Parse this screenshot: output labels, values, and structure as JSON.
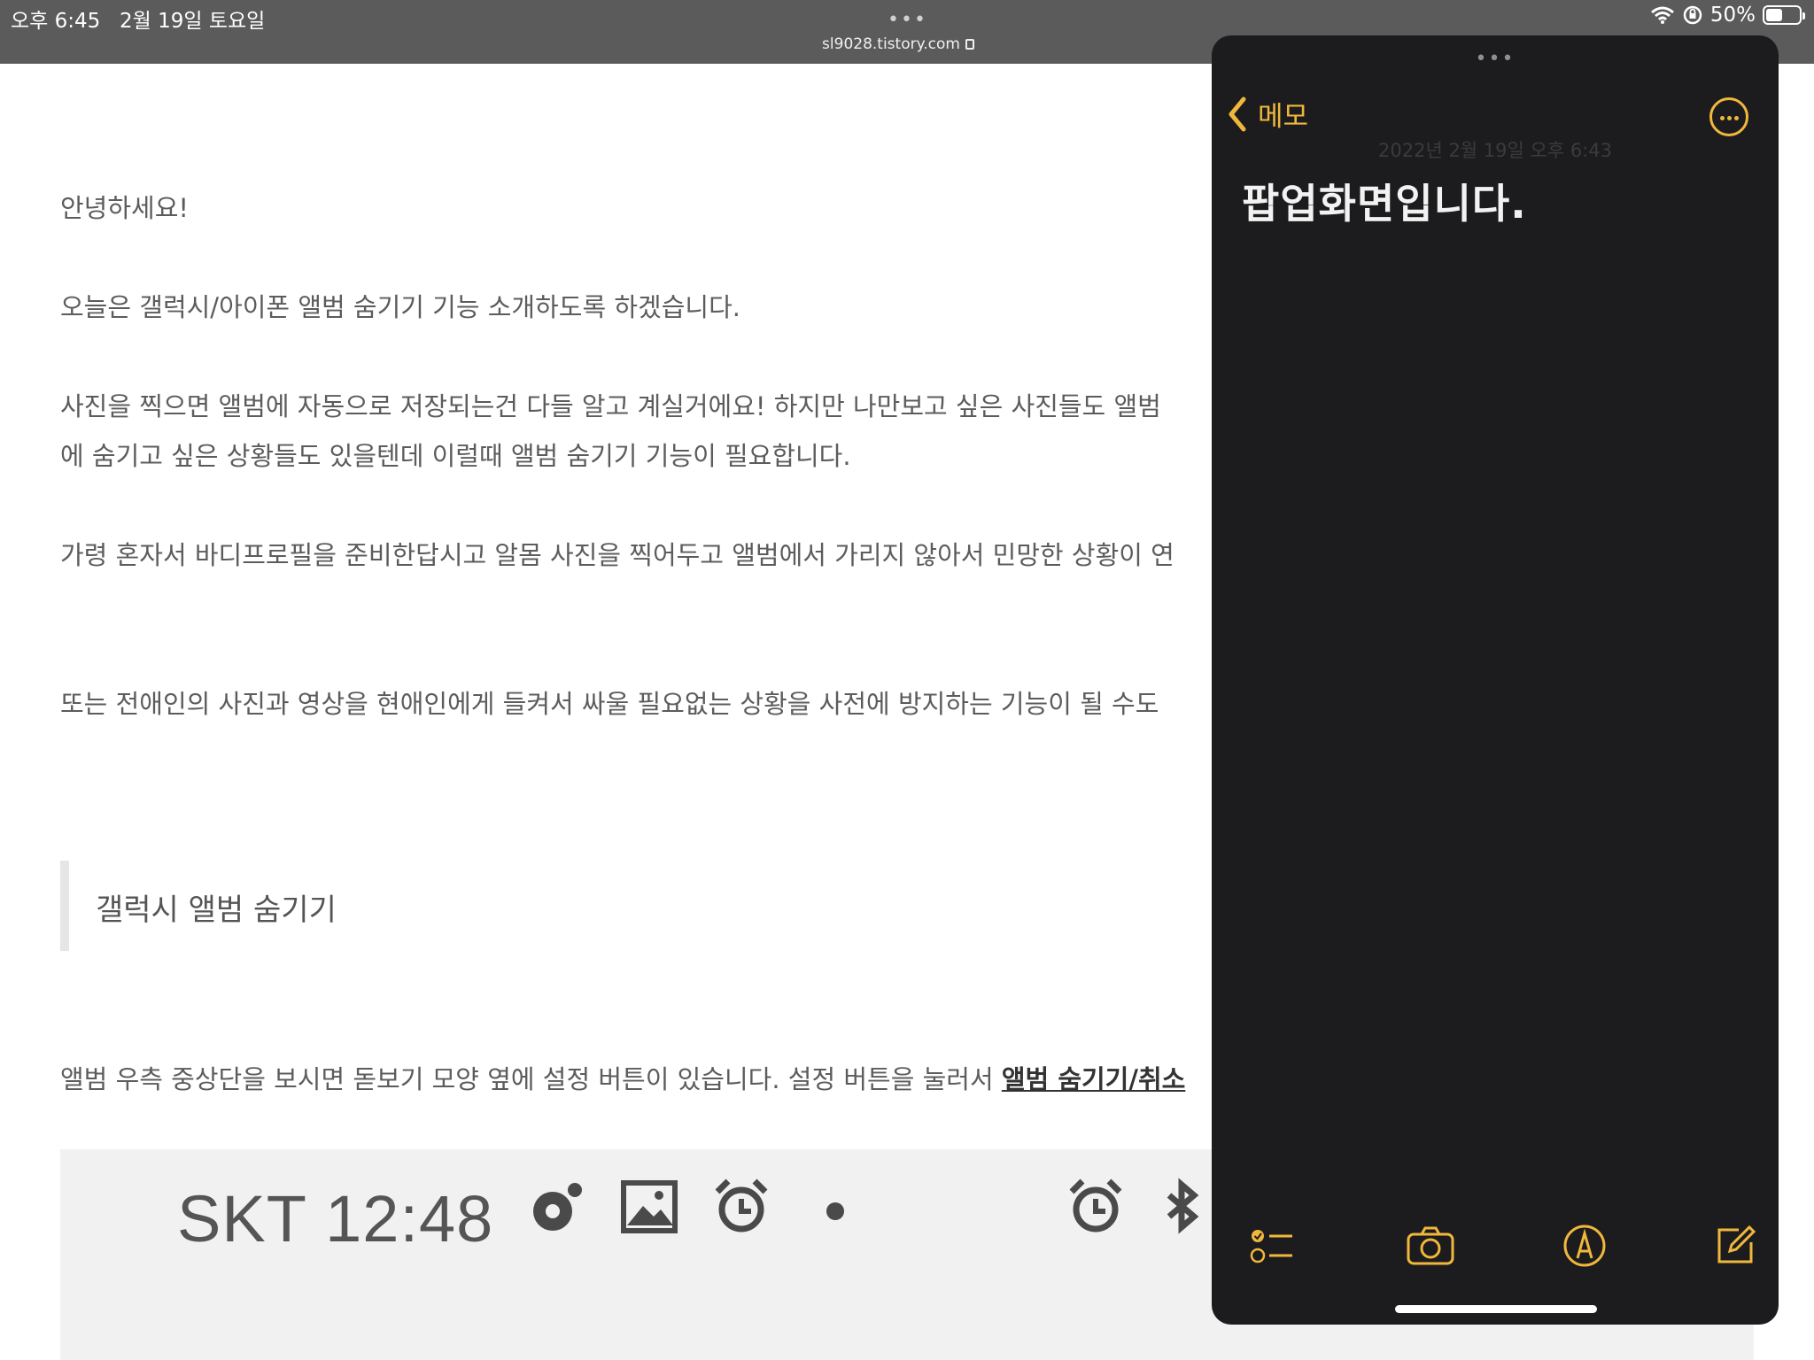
{
  "status_bar": {
    "time": "오후 6:45",
    "date": "2월 19일 토요일",
    "dots": "•••",
    "url": "sl9028.tistory.com",
    "battery_text": "50%",
    "battery_level": 0.5
  },
  "blog": {
    "paragraphs": [
      "안녕하세요!",
      "오늘은 갤럭시/아이폰 앨범 숨기기 기능 소개하도록 하겠습니다.",
      "사진을 찍으면 앨범에 자동으로 저장되는건 다들 알고 계실거에요! 하지만 나만보고 싶은 사진들도 앨범",
      "에 숨기고 싶은 상황들도 있을텐데 이럴때 앨범 숨기기 기능이 필요합니다.",
      "가령 혼자서 바디프로필을 준비한답시고 알몸 사진을 찍어두고 앨범에서 가리지 않아서 민망한 상황이 연",
      "또는 전애인의 사진과 영상을 현애인에게 들켜서 싸울 필요없는 상황을 사전에 방지하는 기능이 될 수도"
    ],
    "quote": "갤럭시 앨범 숨기기",
    "last_paragraph_prefix": "앨범 우측 중상단을 보시면 돋보기 모양 옆에 설정 버튼이 있습니다. 설정 버튼을 눌러서 ",
    "last_paragraph_link": "앨범 숨기기/취소",
    "screenshot_text": "SKT 12:48"
  },
  "notes": {
    "grabber": "•••",
    "back_label": "메모",
    "date_line": "2022년 2월 19일 오후 6:43",
    "body": "팝업화면입니다.",
    "accent_color": "#f0b73c",
    "toolbar_icons": [
      "checklist-icon",
      "camera-icon",
      "markup-icon",
      "compose-icon"
    ]
  }
}
